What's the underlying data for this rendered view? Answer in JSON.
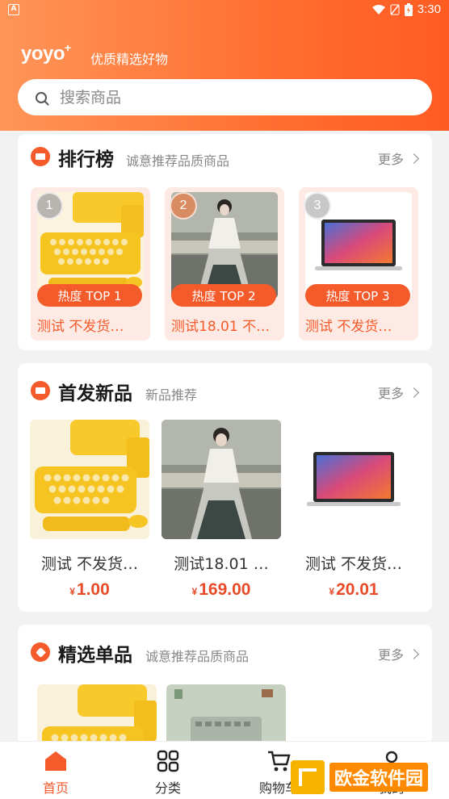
{
  "status_bar": {
    "time": "3:30",
    "app_glyph": "A"
  },
  "header": {
    "brand": "yoyo",
    "brand_plus": "+",
    "slogan": "优质精选好物"
  },
  "search": {
    "placeholder": "搜索商品"
  },
  "ranking": {
    "title": "排行榜",
    "subtitle": "诚意推荐品质商品",
    "more": "更多",
    "items": [
      {
        "rank": "1",
        "badge": "热度 TOP 1",
        "name": "测试 不发货…",
        "image": "keyboard-photo"
      },
      {
        "rank": "2",
        "badge": "热度 TOP 2",
        "name": "测试18.01 不…",
        "image": "hanfu-photo"
      },
      {
        "rank": "3",
        "badge": "热度 TOP 3",
        "name": "测试 不发货…",
        "image": "laptop-photo"
      }
    ]
  },
  "new_arrivals": {
    "title": "首发新品",
    "subtitle": "新品推荐",
    "more": "更多",
    "currency": "¥",
    "items": [
      {
        "name": "测试 不发货…",
        "price": "1.00",
        "image": "keyboard-photo"
      },
      {
        "name": "测试18.01 …",
        "price": "169.00",
        "image": "hanfu-photo"
      },
      {
        "name": "测试 不发货…",
        "price": "20.01",
        "image": "laptop-photo"
      }
    ]
  },
  "picks": {
    "title": "精选单品",
    "subtitle": "诚意推荐品质商品",
    "more": "更多",
    "items": [
      {
        "image": "keyboard-photo"
      },
      {
        "image": "keyboard-green-photo"
      }
    ]
  },
  "tabbar": {
    "items": [
      {
        "label": "首页",
        "icon": "home-icon",
        "active": true
      },
      {
        "label": "分类",
        "icon": "grid-icon",
        "active": false
      },
      {
        "label": "购物车",
        "icon": "cart-icon",
        "active": false
      },
      {
        "label": "我的",
        "icon": "user-icon",
        "active": false
      }
    ]
  },
  "watermark": {
    "text": "欧金软件园"
  },
  "colors": {
    "accent": "#f45a2a",
    "header_from": "#ff9558",
    "header_to": "#ff5b22",
    "price": "#e94b2a"
  }
}
